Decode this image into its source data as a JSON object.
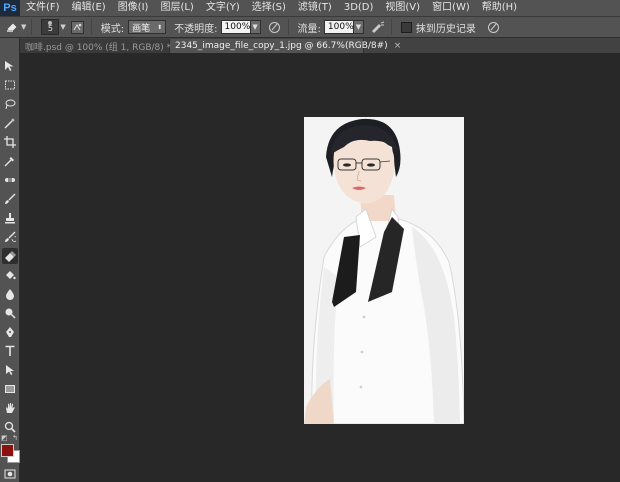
{
  "app": {
    "logo": "Ps"
  },
  "menu": {
    "items": [
      "文件(F)",
      "编辑(E)",
      "图像(I)",
      "图层(L)",
      "文字(Y)",
      "选择(S)",
      "滤镜(T)",
      "3D(D)",
      "视图(V)",
      "窗口(W)",
      "帮助(H)"
    ]
  },
  "options": {
    "brush_size": "5",
    "mode_label": "模式:",
    "mode_value": "画笔",
    "opacity_label": "不透明度:",
    "opacity_value": "100%",
    "flow_label": "流量:",
    "flow_value": "100%",
    "history_label": "抹到历史记录"
  },
  "tabs": [
    {
      "label": "咖啡.psd @ 100% (组 1, RGB/8) *",
      "active": false
    },
    {
      "label": "2345_image_file_copy_1.jpg @ 66.7%(RGB/8#)",
      "active": true
    }
  ],
  "tab_close_glyph": "×",
  "tools": [
    "move-tool",
    "marquee-tool",
    "lasso-tool",
    "magic-wand-tool",
    "crop-tool",
    "eyedropper-tool",
    "healing-brush-tool",
    "brush-tool",
    "clone-stamp-tool",
    "history-brush-tool",
    "eraser-tool",
    "paint-bucket-tool",
    "blur-tool",
    "dodge-tool",
    "pen-tool",
    "type-tool",
    "path-selection-tool",
    "rectangle-tool",
    "hand-tool",
    "zoom-tool"
  ],
  "colors": {
    "foreground": "#8b1010",
    "background": "#ffffff",
    "workspace": "#282828",
    "panel": "#535353"
  }
}
